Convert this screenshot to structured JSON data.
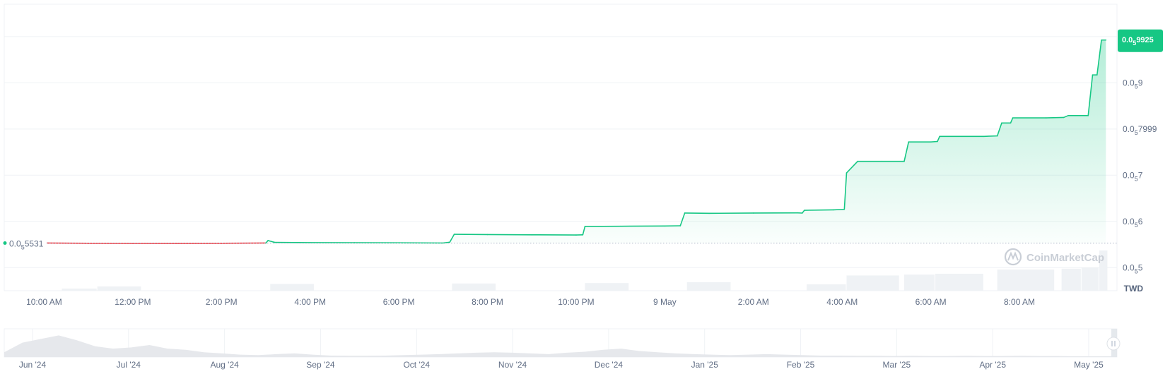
{
  "chart_data": {
    "type": "line",
    "currency_label": "TWD",
    "watermark": "CoinMarketCap",
    "price_prefix": "0.0",
    "price_subscript": "5",
    "y_axis": {
      "min": 0.45,
      "max": 1.07,
      "ticks": [
        {
          "value": 0.5,
          "digits": "5"
        },
        {
          "value": 0.6,
          "digits": "6"
        },
        {
          "value": 0.7,
          "digits": "7"
        },
        {
          "value": 0.7999,
          "digits": "7999"
        },
        {
          "value": 0.9,
          "digits": "9"
        }
      ]
    },
    "x_axis": {
      "start_hour": 9.1,
      "end_hour": 34.2,
      "ticks": [
        {
          "hour": 10,
          "label": "10:00 AM"
        },
        {
          "hour": 12,
          "label": "12:00 PM"
        },
        {
          "hour": 14,
          "label": "2:00 PM"
        },
        {
          "hour": 16,
          "label": "4:00 PM"
        },
        {
          "hour": 18,
          "label": "6:00 PM"
        },
        {
          "hour": 20,
          "label": "8:00 PM"
        },
        {
          "hour": 22,
          "label": "10:00 PM"
        },
        {
          "hour": 24,
          "label": "9 May"
        },
        {
          "hour": 26,
          "label": "2:00 AM"
        },
        {
          "hour": 28,
          "label": "4:00 AM"
        },
        {
          "hour": 30,
          "label": "6:00 AM"
        },
        {
          "hour": 32,
          "label": "8:00 AM"
        }
      ]
    },
    "open_price": {
      "value": 0.5531,
      "digits": "5531"
    },
    "current_price": {
      "value": 0.9925,
      "digits": "9925"
    },
    "colors": {
      "up": "#16c784",
      "down": "#ea3943",
      "grid": "#eff2f5",
      "volume": "#eff2f5",
      "baseline": "#a6b0c3",
      "fill_top": "#16c784"
    },
    "series": [
      {
        "points": [
          [
            10.0,
            0.5531
          ],
          [
            11.0,
            0.5526
          ],
          [
            12.0,
            0.5523
          ],
          [
            13.0,
            0.5524
          ],
          [
            14.0,
            0.5526
          ],
          [
            15.0,
            0.5531
          ],
          [
            15.05,
            0.5585
          ],
          [
            15.2,
            0.5545
          ],
          [
            16.0,
            0.554
          ],
          [
            17.0,
            0.5538
          ],
          [
            18.0,
            0.5535
          ],
          [
            19.0,
            0.5532
          ],
          [
            19.15,
            0.555
          ],
          [
            19.25,
            0.572
          ],
          [
            20.0,
            0.5715
          ],
          [
            21.0,
            0.571
          ],
          [
            22.0,
            0.5705
          ],
          [
            22.15,
            0.571
          ],
          [
            22.2,
            0.589
          ],
          [
            23.0,
            0.5895
          ],
          [
            24.0,
            0.59
          ],
          [
            24.35,
            0.5905
          ],
          [
            24.45,
            0.618
          ],
          [
            25.0,
            0.6175
          ],
          [
            26.0,
            0.618
          ],
          [
            27.0,
            0.6185
          ],
          [
            27.1,
            0.618
          ],
          [
            27.15,
            0.624
          ],
          [
            27.8,
            0.625
          ],
          [
            28.05,
            0.626
          ],
          [
            28.1,
            0.705
          ],
          [
            28.35,
            0.73
          ],
          [
            28.9,
            0.73
          ],
          [
            29.4,
            0.73
          ],
          [
            29.5,
            0.772
          ],
          [
            30.0,
            0.772
          ],
          [
            30.15,
            0.773
          ],
          [
            30.2,
            0.784
          ],
          [
            31.2,
            0.784
          ],
          [
            31.5,
            0.785
          ],
          [
            31.6,
            0.813
          ],
          [
            31.8,
            0.813
          ],
          [
            31.85,
            0.824
          ],
          [
            32.6,
            0.824
          ],
          [
            33.0,
            0.825
          ],
          [
            33.1,
            0.829
          ],
          [
            33.55,
            0.829
          ],
          [
            33.65,
            0.917
          ],
          [
            33.75,
            0.917
          ],
          [
            33.85,
            0.9925
          ],
          [
            33.95,
            0.9925
          ]
        ]
      }
    ],
    "volume": [
      {
        "x0": 10.4,
        "x1": 11.2,
        "level": 0.05
      },
      {
        "x0": 11.2,
        "x1": 12.2,
        "level": 0.1
      },
      {
        "x0": 15.1,
        "x1": 16.1,
        "level": 0.16
      },
      {
        "x0": 19.2,
        "x1": 20.2,
        "level": 0.17
      },
      {
        "x0": 22.2,
        "x1": 23.2,
        "level": 0.18
      },
      {
        "x0": 24.5,
        "x1": 25.5,
        "level": 0.2
      },
      {
        "x0": 27.2,
        "x1": 28.1,
        "level": 0.15
      },
      {
        "x0": 28.1,
        "x1": 29.3,
        "level": 0.36
      },
      {
        "x0": 29.4,
        "x1": 30.1,
        "level": 0.38
      },
      {
        "x0": 30.1,
        "x1": 31.2,
        "level": 0.4
      },
      {
        "x0": 31.5,
        "x1": 32.8,
        "level": 0.5
      },
      {
        "x0": 32.95,
        "x1": 33.4,
        "level": 0.52
      },
      {
        "x0": 33.4,
        "x1": 33.8,
        "level": 0.55
      },
      {
        "x0": 33.8,
        "x1": 34.0,
        "level": 0.95
      }
    ]
  },
  "navigator": {
    "labels": [
      "Jun '24",
      "Jul '24",
      "Aug '24",
      "Sep '24",
      "Oct '24",
      "Nov '24",
      "Dec '24",
      "Jan '25",
      "Feb '25",
      "Mar '25",
      "Apr '25",
      "May '25"
    ],
    "levels": [
      0.2,
      0.6,
      0.75,
      0.9,
      0.7,
      0.45,
      0.35,
      0.4,
      0.5,
      0.35,
      0.3,
      0.2,
      0.15,
      0.1,
      0.08,
      0.12,
      0.15,
      0.1,
      0.06,
      0.05,
      0.05,
      0.06,
      0.08,
      0.1,
      0.12,
      0.15,
      0.18,
      0.2,
      0.18,
      0.15,
      0.12,
      0.18,
      0.22,
      0.3,
      0.35,
      0.25,
      0.2,
      0.15,
      0.12,
      0.1,
      0.08,
      0.1,
      0.12,
      0.1,
      0.08,
      0.06,
      0.06,
      0.05,
      0.05,
      0.04,
      0.05,
      0.04,
      0.04,
      0.05,
      0.04,
      0.04,
      0.05,
      0.04,
      0.04,
      0.03,
      0.03,
      0.03
    ]
  }
}
